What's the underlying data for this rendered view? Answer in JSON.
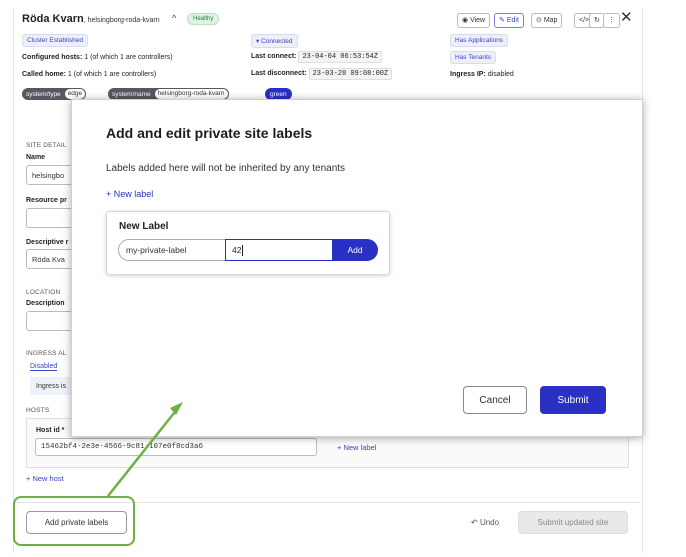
{
  "header": {
    "site_name": "Röda Kvarn",
    "site_slug": "helsingborg-roda-kvarn",
    "health": "Healthy",
    "view_label": "View",
    "edit_label": "Edit",
    "map_label": "Map",
    "code_btn": "</>",
    "refresh_btn": "↻",
    "more_btn": "⋮",
    "close_btn": "✕"
  },
  "status": {
    "cluster": "Cluster Established",
    "connected": "Connected",
    "has_apps": "Has Applications",
    "has_tenants": "Has Tenants",
    "configured_hosts_label": "Configured hosts:",
    "configured_hosts_value": "1 (of which 1 are controllers)",
    "called_home_label": "Called home:",
    "called_home_value": "1 (of which 1 are controllers)",
    "last_connect_label": "Last connect:",
    "last_connect_value": "23-04-04 06:53:54Z",
    "last_disconnect_label": "Last disconnect:",
    "last_disconnect_value": "23-03-28 09:08:00Z",
    "ingress_ip_label": "Ingress IP:",
    "ingress_ip_value": "disabled"
  },
  "labels": [
    {
      "key": "system/type",
      "value": "edge"
    },
    {
      "key": "system/name",
      "value": "helsingborg-roda-kvarn"
    }
  ],
  "label_green": "green",
  "form": {
    "site_details_title": "SITE DETAIL",
    "name_label": "Name",
    "name_value": "helsingbo",
    "resource_label": "Resource pr",
    "descriptive_label": "Descriptive r",
    "descriptive_value": "Röda Kva",
    "location_title": "LOCATION",
    "description_label": "Description",
    "ingress_title": "INGRESS AL",
    "ingress_tab": "Disabled",
    "ingress_text": "Ingress is",
    "hosts_title": "HOSTS",
    "host_id_label": "Host id",
    "host_id_value": "15462bf4-2e3e-4566-9c81-107e0f8cd3a6",
    "host_new_label": "+ New label",
    "new_host": "+ New host"
  },
  "footer": {
    "add_private_labels": "Add private labels",
    "undo": "Undo",
    "submit_updated": "Submit updated site"
  },
  "modal": {
    "title": "Add and edit private site labels",
    "description": "Labels added here will not be inherited by any tenants",
    "new_label_link": "+ New label",
    "card_title": "New Label",
    "key_value": "my-private-label",
    "value_value": "42",
    "add_button": "Add",
    "cancel_button": "Cancel",
    "submit_button": "Submit"
  },
  "colors": {
    "primary": "#2a30c4",
    "highlight": "#6fb044",
    "healthy_bg": "#dff3e4"
  }
}
